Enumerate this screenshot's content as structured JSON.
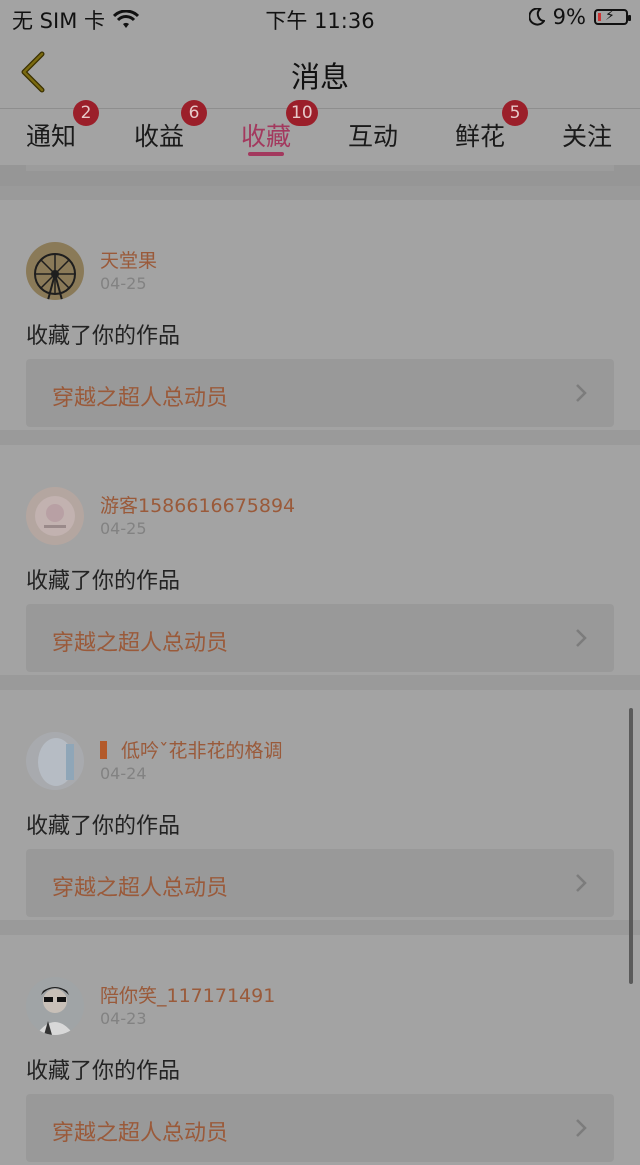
{
  "status_bar": {
    "carrier": "无 SIM 卡",
    "time": "下午 11:36",
    "battery": "9%"
  },
  "nav": {
    "title": "消息"
  },
  "tabs": [
    {
      "label": "通知",
      "badge": "2"
    },
    {
      "label": "收益",
      "badge": "6"
    },
    {
      "label": "收藏",
      "badge": "10",
      "active": true
    },
    {
      "label": "互动",
      "badge": ""
    },
    {
      "label": "鲜花",
      "badge": "5"
    },
    {
      "label": "关注",
      "badge": ""
    }
  ],
  "items": [
    {
      "user": "天堂果",
      "date": "04-25",
      "action": "收藏了你的作品",
      "work": "穿越之超人总动员"
    },
    {
      "user": "游客1586616675894",
      "date": "04-25",
      "action": "收藏了你的作品",
      "work": "穿越之超人总动员"
    },
    {
      "user": "低吟ˇ花非花的格调",
      "date": "04-24",
      "action": "收藏了你的作品",
      "work": "穿越之超人总动员"
    },
    {
      "user": "陪你笑_117171491",
      "date": "04-23",
      "action": "收藏了你的作品",
      "work": "穿越之超人总动员"
    }
  ],
  "colors": {
    "accent": "#a3395e",
    "badge": "#9b1f2a",
    "link": "#9a5a3a"
  }
}
